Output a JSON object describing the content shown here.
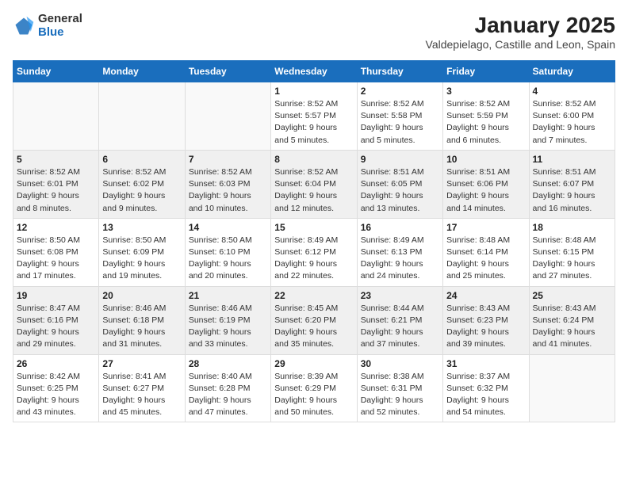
{
  "header": {
    "logo_general": "General",
    "logo_blue": "Blue",
    "title": "January 2025",
    "subtitle": "Valdepielago, Castille and Leon, Spain"
  },
  "weekdays": [
    "Sunday",
    "Monday",
    "Tuesday",
    "Wednesday",
    "Thursday",
    "Friday",
    "Saturday"
  ],
  "weeks": [
    [
      {
        "day": "",
        "info": ""
      },
      {
        "day": "",
        "info": ""
      },
      {
        "day": "",
        "info": ""
      },
      {
        "day": "1",
        "info": "Sunrise: 8:52 AM\nSunset: 5:57 PM\nDaylight: 9 hours\nand 5 minutes."
      },
      {
        "day": "2",
        "info": "Sunrise: 8:52 AM\nSunset: 5:58 PM\nDaylight: 9 hours\nand 5 minutes."
      },
      {
        "day": "3",
        "info": "Sunrise: 8:52 AM\nSunset: 5:59 PM\nDaylight: 9 hours\nand 6 minutes."
      },
      {
        "day": "4",
        "info": "Sunrise: 8:52 AM\nSunset: 6:00 PM\nDaylight: 9 hours\nand 7 minutes."
      }
    ],
    [
      {
        "day": "5",
        "info": "Sunrise: 8:52 AM\nSunset: 6:01 PM\nDaylight: 9 hours\nand 8 minutes."
      },
      {
        "day": "6",
        "info": "Sunrise: 8:52 AM\nSunset: 6:02 PM\nDaylight: 9 hours\nand 9 minutes."
      },
      {
        "day": "7",
        "info": "Sunrise: 8:52 AM\nSunset: 6:03 PM\nDaylight: 9 hours\nand 10 minutes."
      },
      {
        "day": "8",
        "info": "Sunrise: 8:52 AM\nSunset: 6:04 PM\nDaylight: 9 hours\nand 12 minutes."
      },
      {
        "day": "9",
        "info": "Sunrise: 8:51 AM\nSunset: 6:05 PM\nDaylight: 9 hours\nand 13 minutes."
      },
      {
        "day": "10",
        "info": "Sunrise: 8:51 AM\nSunset: 6:06 PM\nDaylight: 9 hours\nand 14 minutes."
      },
      {
        "day": "11",
        "info": "Sunrise: 8:51 AM\nSunset: 6:07 PM\nDaylight: 9 hours\nand 16 minutes."
      }
    ],
    [
      {
        "day": "12",
        "info": "Sunrise: 8:50 AM\nSunset: 6:08 PM\nDaylight: 9 hours\nand 17 minutes."
      },
      {
        "day": "13",
        "info": "Sunrise: 8:50 AM\nSunset: 6:09 PM\nDaylight: 9 hours\nand 19 minutes."
      },
      {
        "day": "14",
        "info": "Sunrise: 8:50 AM\nSunset: 6:10 PM\nDaylight: 9 hours\nand 20 minutes."
      },
      {
        "day": "15",
        "info": "Sunrise: 8:49 AM\nSunset: 6:12 PM\nDaylight: 9 hours\nand 22 minutes."
      },
      {
        "day": "16",
        "info": "Sunrise: 8:49 AM\nSunset: 6:13 PM\nDaylight: 9 hours\nand 24 minutes."
      },
      {
        "day": "17",
        "info": "Sunrise: 8:48 AM\nSunset: 6:14 PM\nDaylight: 9 hours\nand 25 minutes."
      },
      {
        "day": "18",
        "info": "Sunrise: 8:48 AM\nSunset: 6:15 PM\nDaylight: 9 hours\nand 27 minutes."
      }
    ],
    [
      {
        "day": "19",
        "info": "Sunrise: 8:47 AM\nSunset: 6:16 PM\nDaylight: 9 hours\nand 29 minutes."
      },
      {
        "day": "20",
        "info": "Sunrise: 8:46 AM\nSunset: 6:18 PM\nDaylight: 9 hours\nand 31 minutes."
      },
      {
        "day": "21",
        "info": "Sunrise: 8:46 AM\nSunset: 6:19 PM\nDaylight: 9 hours\nand 33 minutes."
      },
      {
        "day": "22",
        "info": "Sunrise: 8:45 AM\nSunset: 6:20 PM\nDaylight: 9 hours\nand 35 minutes."
      },
      {
        "day": "23",
        "info": "Sunrise: 8:44 AM\nSunset: 6:21 PM\nDaylight: 9 hours\nand 37 minutes."
      },
      {
        "day": "24",
        "info": "Sunrise: 8:43 AM\nSunset: 6:23 PM\nDaylight: 9 hours\nand 39 minutes."
      },
      {
        "day": "25",
        "info": "Sunrise: 8:43 AM\nSunset: 6:24 PM\nDaylight: 9 hours\nand 41 minutes."
      }
    ],
    [
      {
        "day": "26",
        "info": "Sunrise: 8:42 AM\nSunset: 6:25 PM\nDaylight: 9 hours\nand 43 minutes."
      },
      {
        "day": "27",
        "info": "Sunrise: 8:41 AM\nSunset: 6:27 PM\nDaylight: 9 hours\nand 45 minutes."
      },
      {
        "day": "28",
        "info": "Sunrise: 8:40 AM\nSunset: 6:28 PM\nDaylight: 9 hours\nand 47 minutes."
      },
      {
        "day": "29",
        "info": "Sunrise: 8:39 AM\nSunset: 6:29 PM\nDaylight: 9 hours\nand 50 minutes."
      },
      {
        "day": "30",
        "info": "Sunrise: 8:38 AM\nSunset: 6:31 PM\nDaylight: 9 hours\nand 52 minutes."
      },
      {
        "day": "31",
        "info": "Sunrise: 8:37 AM\nSunset: 6:32 PM\nDaylight: 9 hours\nand 54 minutes."
      },
      {
        "day": "",
        "info": ""
      }
    ]
  ]
}
